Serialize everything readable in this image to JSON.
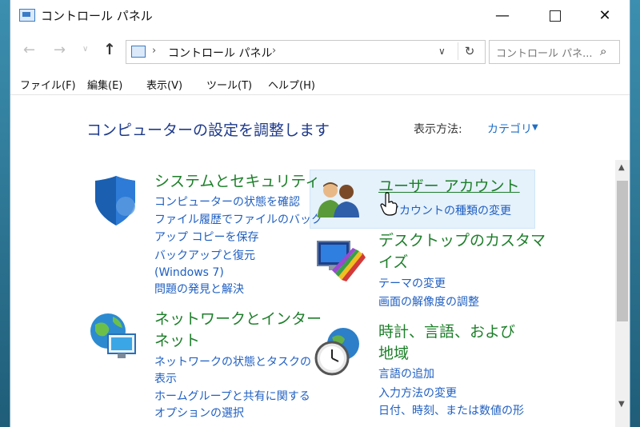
{
  "window": {
    "title": "コントロール パネル",
    "controls": {
      "minimize": "—",
      "maximize": "",
      "close": "✕"
    }
  },
  "nav": {
    "back": "←",
    "forward": "→",
    "recent": "∨",
    "up": "↑",
    "breadcrumb_sep": "›",
    "breadcrumb": "コントロール パネル",
    "dropdown": "∨",
    "refresh": "↻",
    "search_placeholder": "コントロール パネ...",
    "search_icon": "⌕"
  },
  "menu": [
    "ファイル(F)",
    "編集(E)",
    "表示(V)",
    "ツール(T)",
    "ヘルプ(H)"
  ],
  "content": {
    "heading": "コンピューターの設定を調整します",
    "view_by_label": "表示方法:",
    "view_by_value": "カテゴリ",
    "view_by_arrow": "▼"
  },
  "categories": [
    {
      "title": "システムとセキュリティ",
      "icon": "shield-icon",
      "links": [
        "コンピューターの状態を確認",
        "ファイル履歴でファイルのバック",
        "アップ コピーを保存",
        "バックアップと復元",
        "(Windows 7)",
        "問題の発見と解決"
      ]
    },
    {
      "title_lines": [
        "ネットワークとインター",
        "ネット"
      ],
      "icon": "network-globe-icon",
      "links": [
        "ネットワークの状態とタスクの",
        "表示",
        "ホームグループと共有に関する",
        "オプションの選択"
      ]
    },
    {
      "title": "ユーザー アカウント",
      "icon": "users-icon",
      "links": [
        "アカウントの種類の変更"
      ]
    },
    {
      "title_lines": [
        "デスクトップのカスタマ",
        "イズ"
      ],
      "icon": "monitor-palette-icon",
      "links": [
        "テーマの変更",
        "画面の解像度の調整"
      ]
    },
    {
      "title_lines": [
        "時計、言語、および",
        "地域"
      ],
      "icon": "clock-globe-icon",
      "links": [
        "言語の追加",
        "入力方法の変更",
        "日付、時刻、または数値の形"
      ]
    }
  ],
  "scrollbar": {
    "up": "▲",
    "down": "▼"
  },
  "colors": {
    "heading": "#1e3a8a",
    "category_title": "#1d7f2a",
    "link": "#1f5fc2",
    "hover": "#e5f1fb"
  }
}
